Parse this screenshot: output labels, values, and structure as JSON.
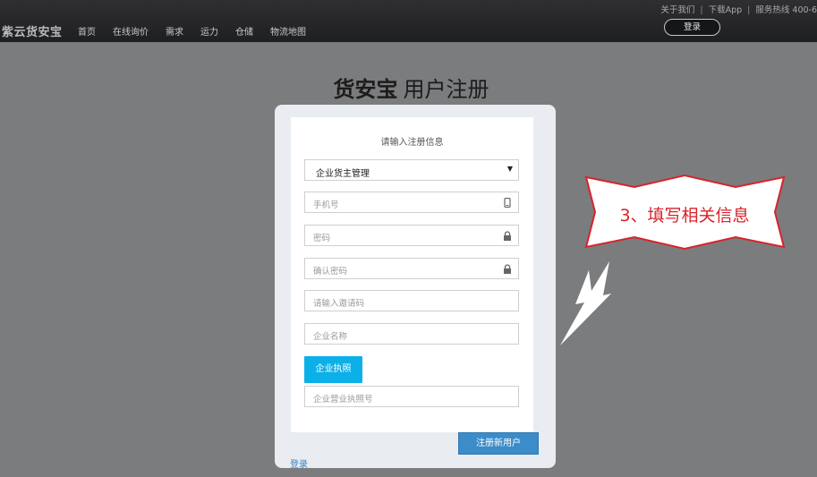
{
  "header": {
    "brand": "紫云货安宝",
    "nav": [
      "首页",
      "在线询价",
      "需求",
      "运力",
      "仓储",
      "物流地图"
    ],
    "top_links": {
      "about": "关于我们",
      "separator": "|",
      "download": "下载App",
      "hotline": "服务热线 400-6"
    },
    "login_button": "登录"
  },
  "page": {
    "title_brand": "货安宝",
    "title_text": "用户注册"
  },
  "form": {
    "heading": "请输入注册信息",
    "role_select": {
      "value": "企业货主管理"
    },
    "phone": {
      "placeholder": "手机号",
      "icon": "mobile-phone-icon"
    },
    "password": {
      "placeholder": "密码",
      "icon": "lock-icon"
    },
    "confirm_password": {
      "placeholder": "确认密码",
      "icon": "lock-icon"
    },
    "invite_code": {
      "placeholder": "请输入邀请码"
    },
    "company_name": {
      "placeholder": "企业名称"
    },
    "license_button": "企业执照",
    "license_number": {
      "placeholder": "企业营业执照号"
    },
    "register_button": "注册新用户",
    "login_link": "登录"
  },
  "annotation": {
    "text": "3、填写相关信息",
    "text_color": "#d8232a",
    "border_color": "#d8232a"
  },
  "colors": {
    "background": "#7b7c7e",
    "header": "#232426",
    "license_button": "#0cb0e8",
    "register_button": "#3b8cc9",
    "link": "#3b7fc4"
  }
}
